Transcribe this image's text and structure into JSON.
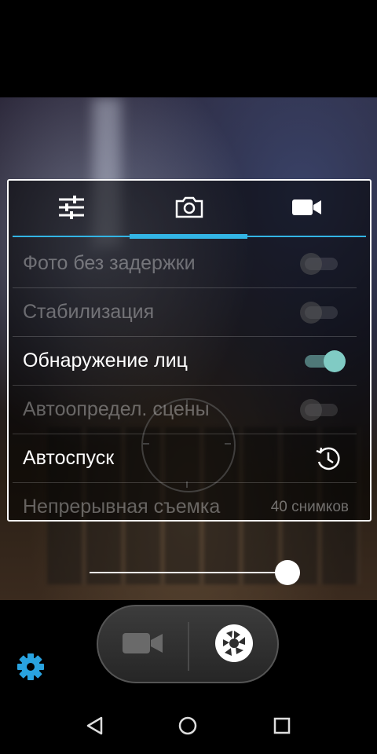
{
  "settings": {
    "tabs": [
      {
        "icon": "sliders-icon"
      },
      {
        "icon": "camera-icon",
        "active": true
      },
      {
        "icon": "video-camera-icon"
      }
    ],
    "rows": [
      {
        "label": "Фото без задержки",
        "control": "switch",
        "enabled": false,
        "on": false
      },
      {
        "label": "Стабилизация",
        "control": "switch",
        "enabled": false,
        "on": false
      },
      {
        "label": "Обнаружение лиц",
        "control": "switch",
        "enabled": true,
        "on": true
      },
      {
        "label": "Автоопредел. сцены",
        "control": "switch",
        "enabled": false,
        "on": false
      },
      {
        "label": "Автоспуск",
        "control": "timer-icon",
        "enabled": true
      },
      {
        "label": "Непрерывная съемка",
        "value": "40 снимков",
        "enabled": false
      }
    ]
  },
  "zoom_slider": {
    "level": 0.95
  },
  "mode_switch": {
    "left": "video-camera-icon",
    "right": "shutter-icon"
  },
  "settings_button": {
    "icon": "gear-icon"
  },
  "navigation": {
    "back": "back-icon",
    "home": "home-icon",
    "recents": "recents-icon"
  },
  "colors": {
    "accent": "#33b5e5",
    "switch_on": "#80cbc4",
    "gear": "#29a3e0"
  }
}
